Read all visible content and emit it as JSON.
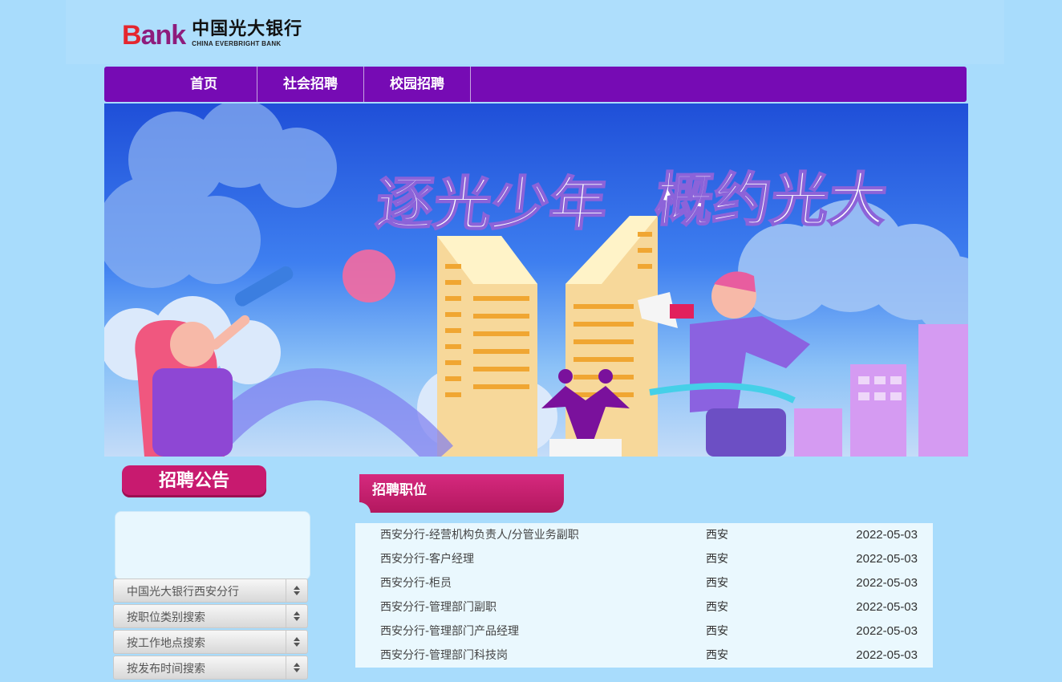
{
  "logo": {
    "bank": "Bank",
    "zh": "中国光大银行",
    "en": "CHINA EVERBRIGHT BANK"
  },
  "nav": {
    "items": [
      "首页",
      "社会招聘",
      "校园招聘"
    ]
  },
  "banner": {
    "slogan_left": "逐光少年",
    "slogan_right": "概约光大"
  },
  "notice": {
    "title": "招聘公告"
  },
  "filters": [
    "中国光大银行西安分行",
    "按职位类别搜索",
    "按工作地点搜索",
    "按发布时间搜索"
  ],
  "jobs": {
    "title": "招聘职位",
    "rows": [
      {
        "title": "西安分行-经营机构负责人/分管业务副职",
        "city": "西安",
        "date": "2022-05-03"
      },
      {
        "title": "西安分行-客户经理",
        "city": "西安",
        "date": "2022-05-03"
      },
      {
        "title": "西安分行-柜员",
        "city": "西安",
        "date": "2022-05-03"
      },
      {
        "title": "西安分行-管理部门副职",
        "city": "西安",
        "date": "2022-05-03"
      },
      {
        "title": "西安分行-管理部门产品经理",
        "city": "西安",
        "date": "2022-05-03"
      },
      {
        "title": "西安分行-管理部门科技岗",
        "city": "西安",
        "date": "2022-05-03"
      }
    ]
  },
  "colors": {
    "nav": "#760bb4",
    "accent": "#c81a6f",
    "page_bg": "#a8dcfc"
  }
}
